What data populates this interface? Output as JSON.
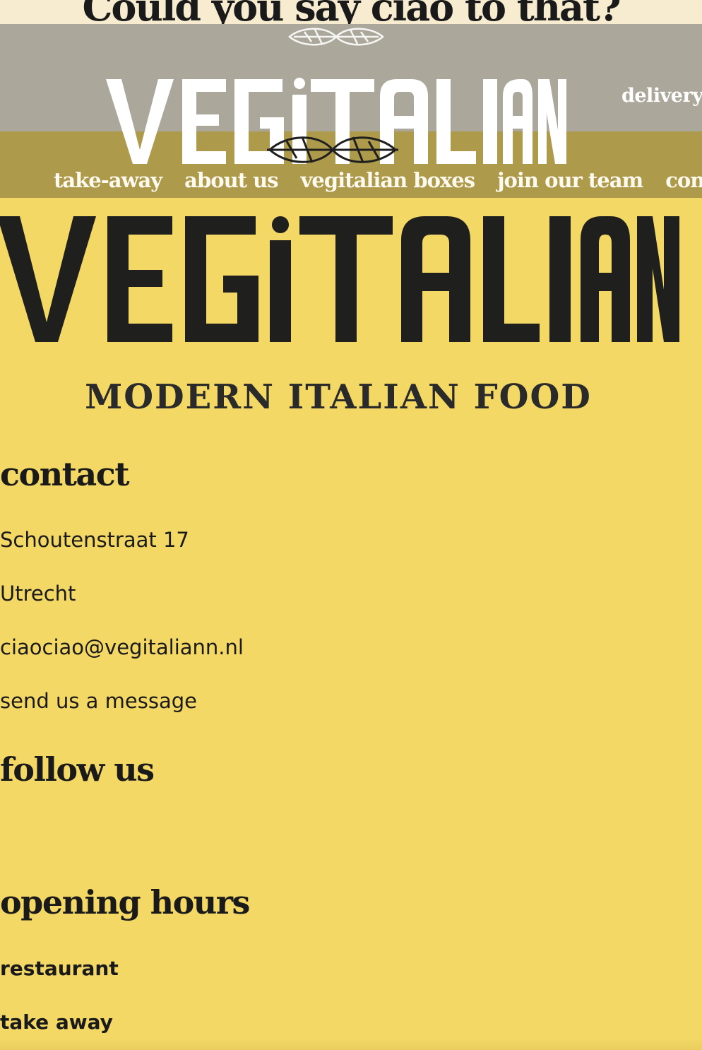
{
  "top_banner": {
    "tagline": "Could you say ciao to that?"
  },
  "header": {
    "logo_alt": "VEGITALIAN",
    "delivery_label": "delivery",
    "nav": [
      {
        "label": "take-away"
      },
      {
        "label": "about us"
      },
      {
        "label": "vegitalian boxes"
      },
      {
        "label": "join our team"
      },
      {
        "label": "contact"
      }
    ]
  },
  "hero": {
    "logo_text": "VEGITALIAN",
    "subtitle": "MODERN ITALIAN FOOD"
  },
  "contact": {
    "heading": "contact",
    "street": "Schoutenstraat 17",
    "city": "Utrecht",
    "email": "ciaociao@vegitaliann.nl",
    "message_link": "send us a message"
  },
  "follow": {
    "heading": "follow us"
  },
  "hours": {
    "heading": "opening hours",
    "restaurant_label": "restaurant",
    "takeaway_label": "take away"
  },
  "colors": {
    "page_background": "#f4d866",
    "header_upper": "#aba89b",
    "header_lower": "#ad9a4a",
    "top_strip": "#f7eccf",
    "text_dark": "#1a1a1a"
  },
  "icons": [
    "leaf-ornament-icon",
    "vegitalian-logo"
  ]
}
